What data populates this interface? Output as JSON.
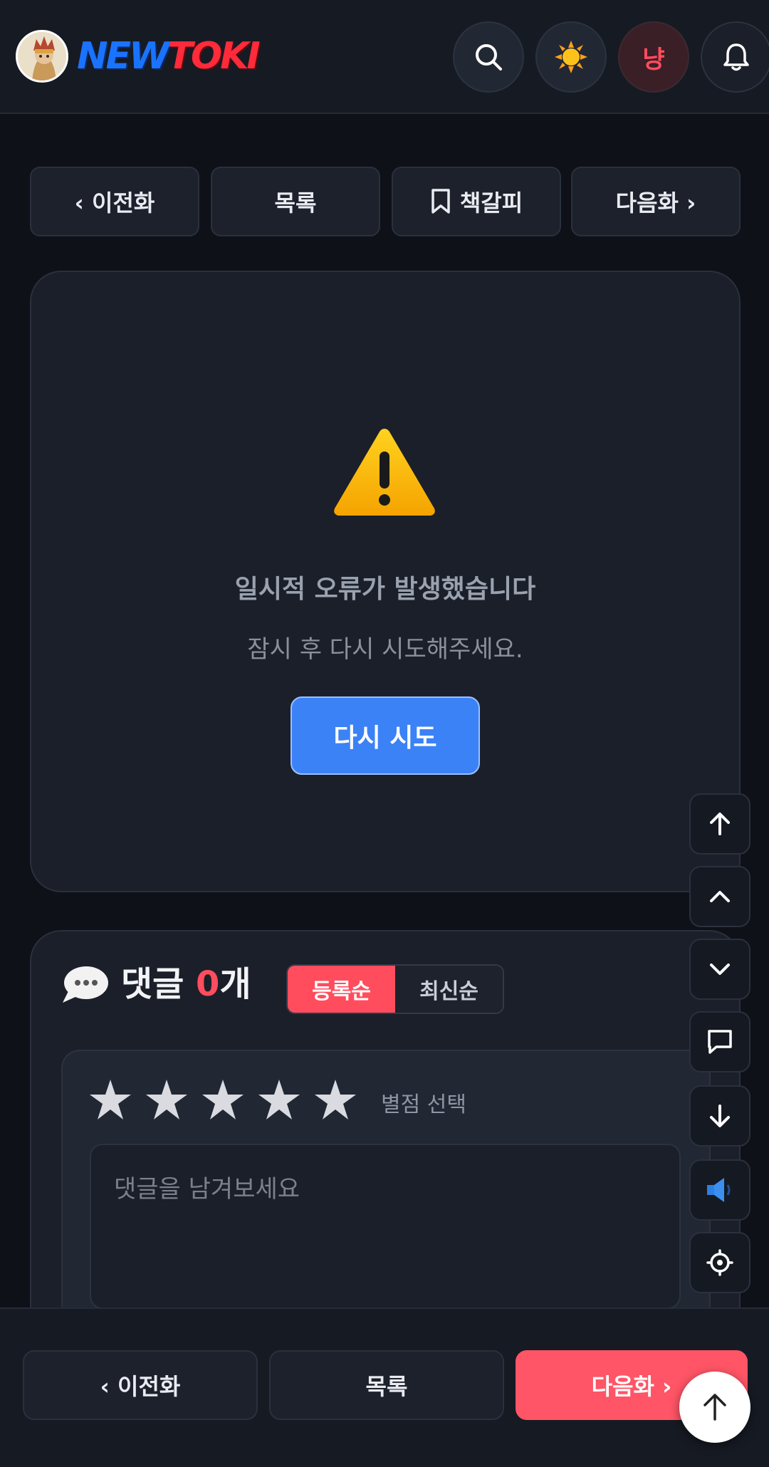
{
  "header": {
    "logo_text_new": "NEW",
    "logo_text_toki": "TOKI",
    "user_initial": "냥",
    "icons": [
      "search-icon",
      "sun-icon",
      "bell-icon"
    ]
  },
  "top_nav": {
    "prev_label": "‹ 이전화",
    "list_label": "목록",
    "bookmark_label": "책갈피",
    "next_label": "다음화 ›"
  },
  "error": {
    "title": "일시적 오류가 발생했습니다",
    "subtitle": "잠시 후 다시 시도해주세요.",
    "retry_label": "다시 시도"
  },
  "comments": {
    "title_prefix": "댓글 ",
    "count": "0",
    "title_suffix": "개",
    "sort_options": [
      "등록순",
      "최신순"
    ],
    "active_sort": "등록순",
    "rating_label": "별점 선택",
    "star_count": 5,
    "input_placeholder": "댓글을 남겨보세요"
  },
  "side_controls": [
    "arrow-up-icon",
    "chevron-up-icon",
    "chevron-down-icon",
    "comment-icon",
    "arrow-down-icon",
    "speaker-icon",
    "settings-icon"
  ],
  "bottom_nav": {
    "prev_label": "‹ 이전화",
    "list_label": "목록",
    "next_label": "다음화 ›"
  },
  "colors": {
    "background": "#0e1117",
    "card": "#1b1f29",
    "accent_red": "#ff4d5e",
    "accent_blue": "#3b82f6"
  }
}
